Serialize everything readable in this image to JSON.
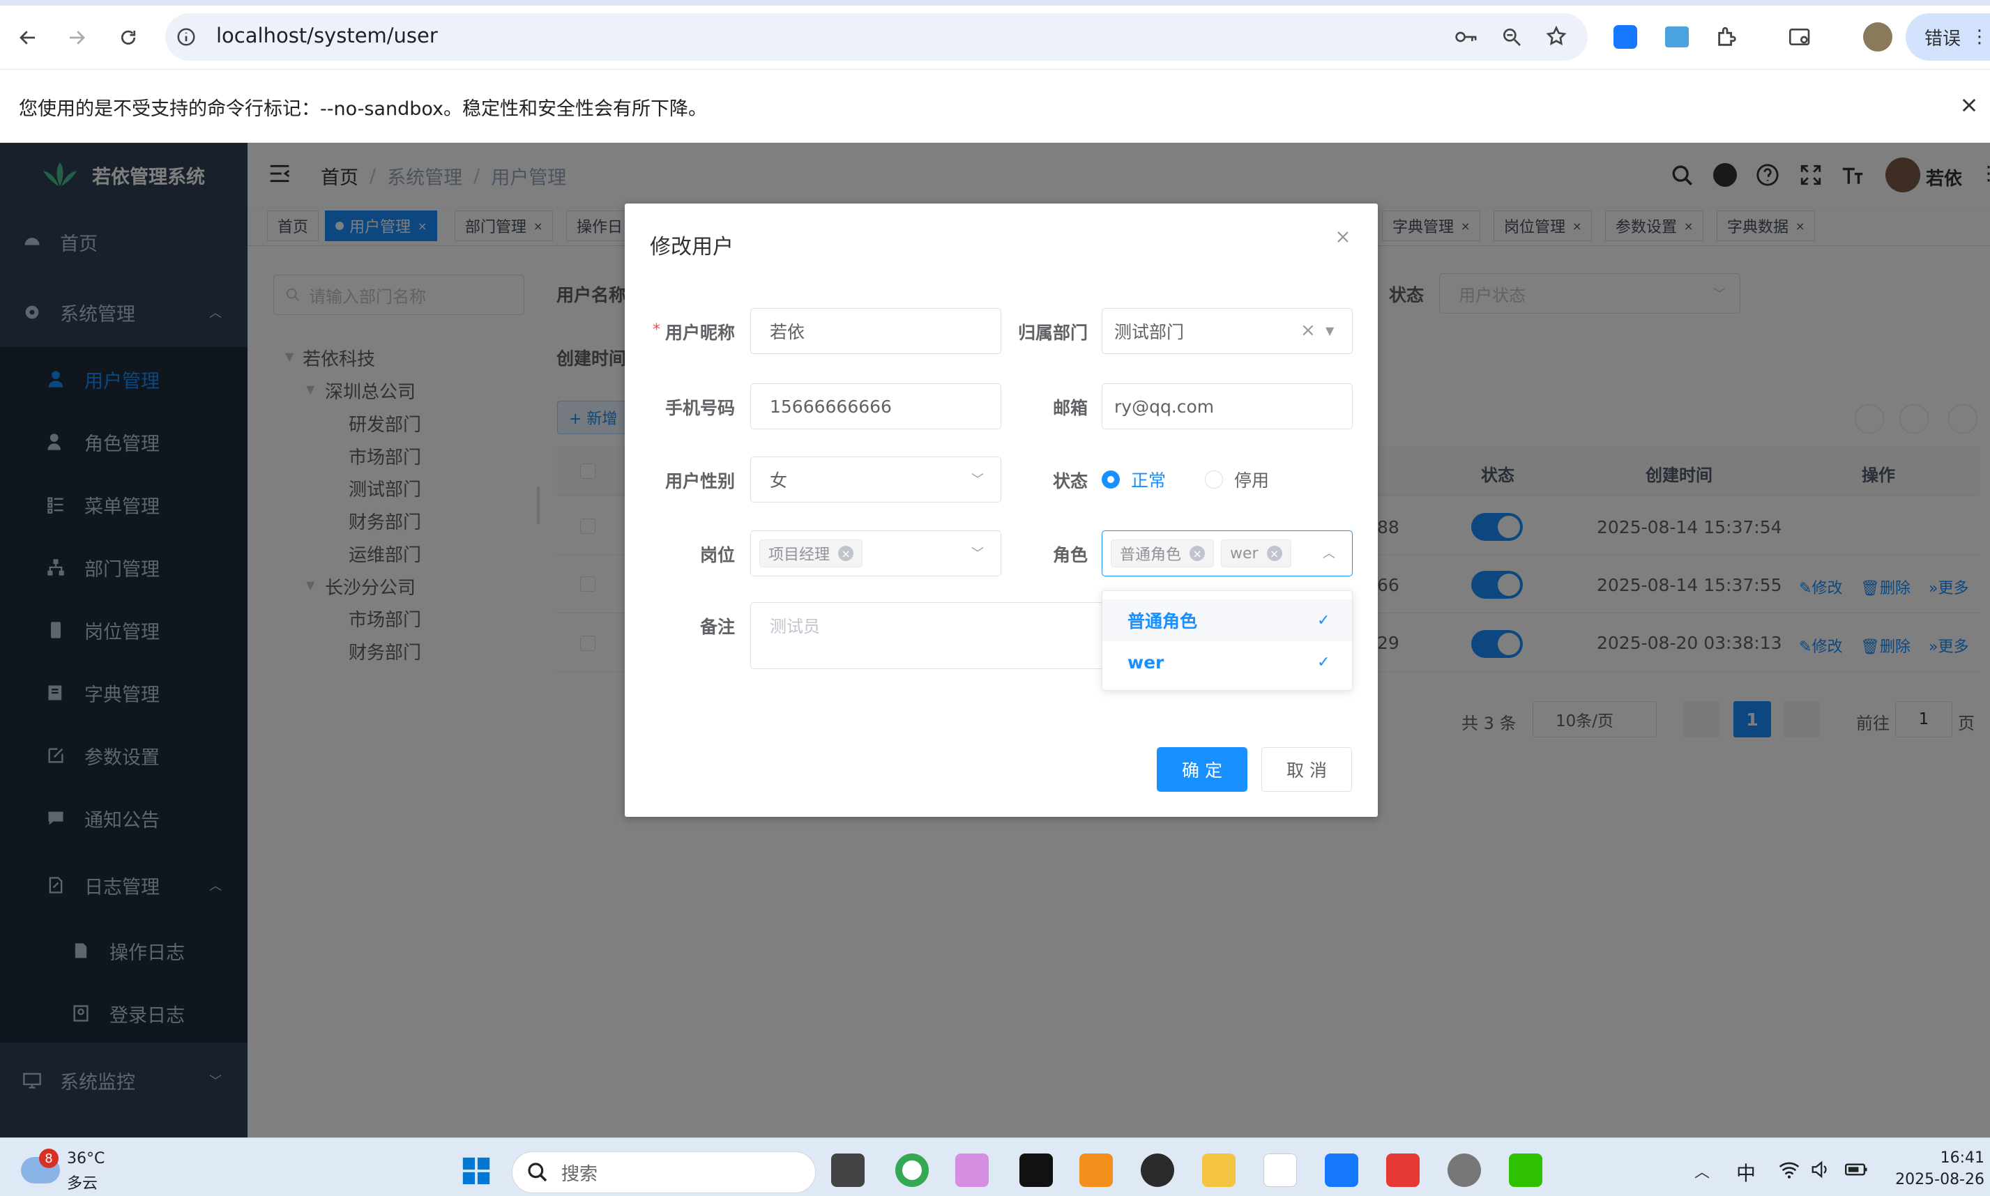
{
  "browser": {
    "url": "localhost/system/user",
    "error_label": "错误",
    "infobar_text": "您使用的是不受支持的命令行标记：--no-sandbox。稳定性和安全性会有所下降。"
  },
  "app": {
    "title": "若依管理系统",
    "user_name": "若依",
    "breadcrumb": [
      "首页",
      "系统管理",
      "用户管理"
    ]
  },
  "sidebar": {
    "home": "首页",
    "system": "系统管理",
    "items": [
      "用户管理",
      "角色管理",
      "菜单管理",
      "部门管理",
      "岗位管理",
      "字典管理",
      "参数设置",
      "通知公告"
    ],
    "log": "日志管理",
    "log_items": [
      "操作日志",
      "登录日志"
    ],
    "monitor": "系统监控"
  },
  "tags": [
    "首页",
    "用户管理",
    "部门管理",
    "操作日",
    "字典管理",
    "岗位管理",
    "参数设置",
    "字典数据"
  ],
  "tree": {
    "search_placeholder": "请输入部门名称",
    "nodes": [
      "若依科技",
      "深圳总公司",
      "研发部门",
      "市场部门",
      "测试部门",
      "财务部门",
      "运维部门",
      "长沙分公司",
      "市场部门",
      "财务部门"
    ]
  },
  "search": {
    "username_label": "用户名称",
    "created_label": "创建时间",
    "status_label": "状态",
    "status_placeholder": "用户状态",
    "add_button": "+ 新增"
  },
  "table": {
    "headers": {
      "status": "状态",
      "created": "创建时间",
      "actions": "操作"
    },
    "rows": [
      {
        "phone_tail": "88",
        "created": "2025-08-14 15:37:54",
        "enabled": true
      },
      {
        "phone_tail": "66",
        "created": "2025-08-14 15:37:55",
        "enabled": true
      },
      {
        "phone_tail": "29",
        "created": "2025-08-20 03:38:13",
        "enabled": true
      }
    ],
    "actions": [
      "修改",
      "删除",
      "更多"
    ]
  },
  "pagination": {
    "total": "共 3 条",
    "page_size": "10条/页",
    "current": "1",
    "goto_label": "前往",
    "goto_value": "1",
    "page_suffix": "页"
  },
  "dialog": {
    "title": "修改用户",
    "labels": {
      "nickname": "用户昵称",
      "dept": "归属部门",
      "phone": "手机号码",
      "email": "邮箱",
      "gender": "用户性别",
      "status": "状态",
      "post": "岗位",
      "role": "角色",
      "remark": "备注"
    },
    "values": {
      "nickname": "若依",
      "dept": "测试部门",
      "phone": "15666666666",
      "email": "ry@qq.com",
      "gender": "女",
      "remark_placeholder": "测试员"
    },
    "status_options": [
      "正常",
      "停用"
    ],
    "status_selected": "正常",
    "post_tags": [
      "项目经理"
    ],
    "role_tags": [
      "普通角色",
      "wer"
    ],
    "role_options": [
      "普通角色",
      "wer"
    ],
    "confirm": "确 定",
    "cancel": "取 消"
  },
  "taskbar": {
    "weather_temp": "36°C",
    "weather_desc": "多云",
    "weather_badge": "8",
    "search_placeholder": "搜索",
    "ime": "中",
    "time": "16:41",
    "date": "2025-08-26"
  },
  "colors": {
    "primary": "#1890ff",
    "sidebar": "#304156",
    "sidebar_sub": "#1f2d3d"
  }
}
